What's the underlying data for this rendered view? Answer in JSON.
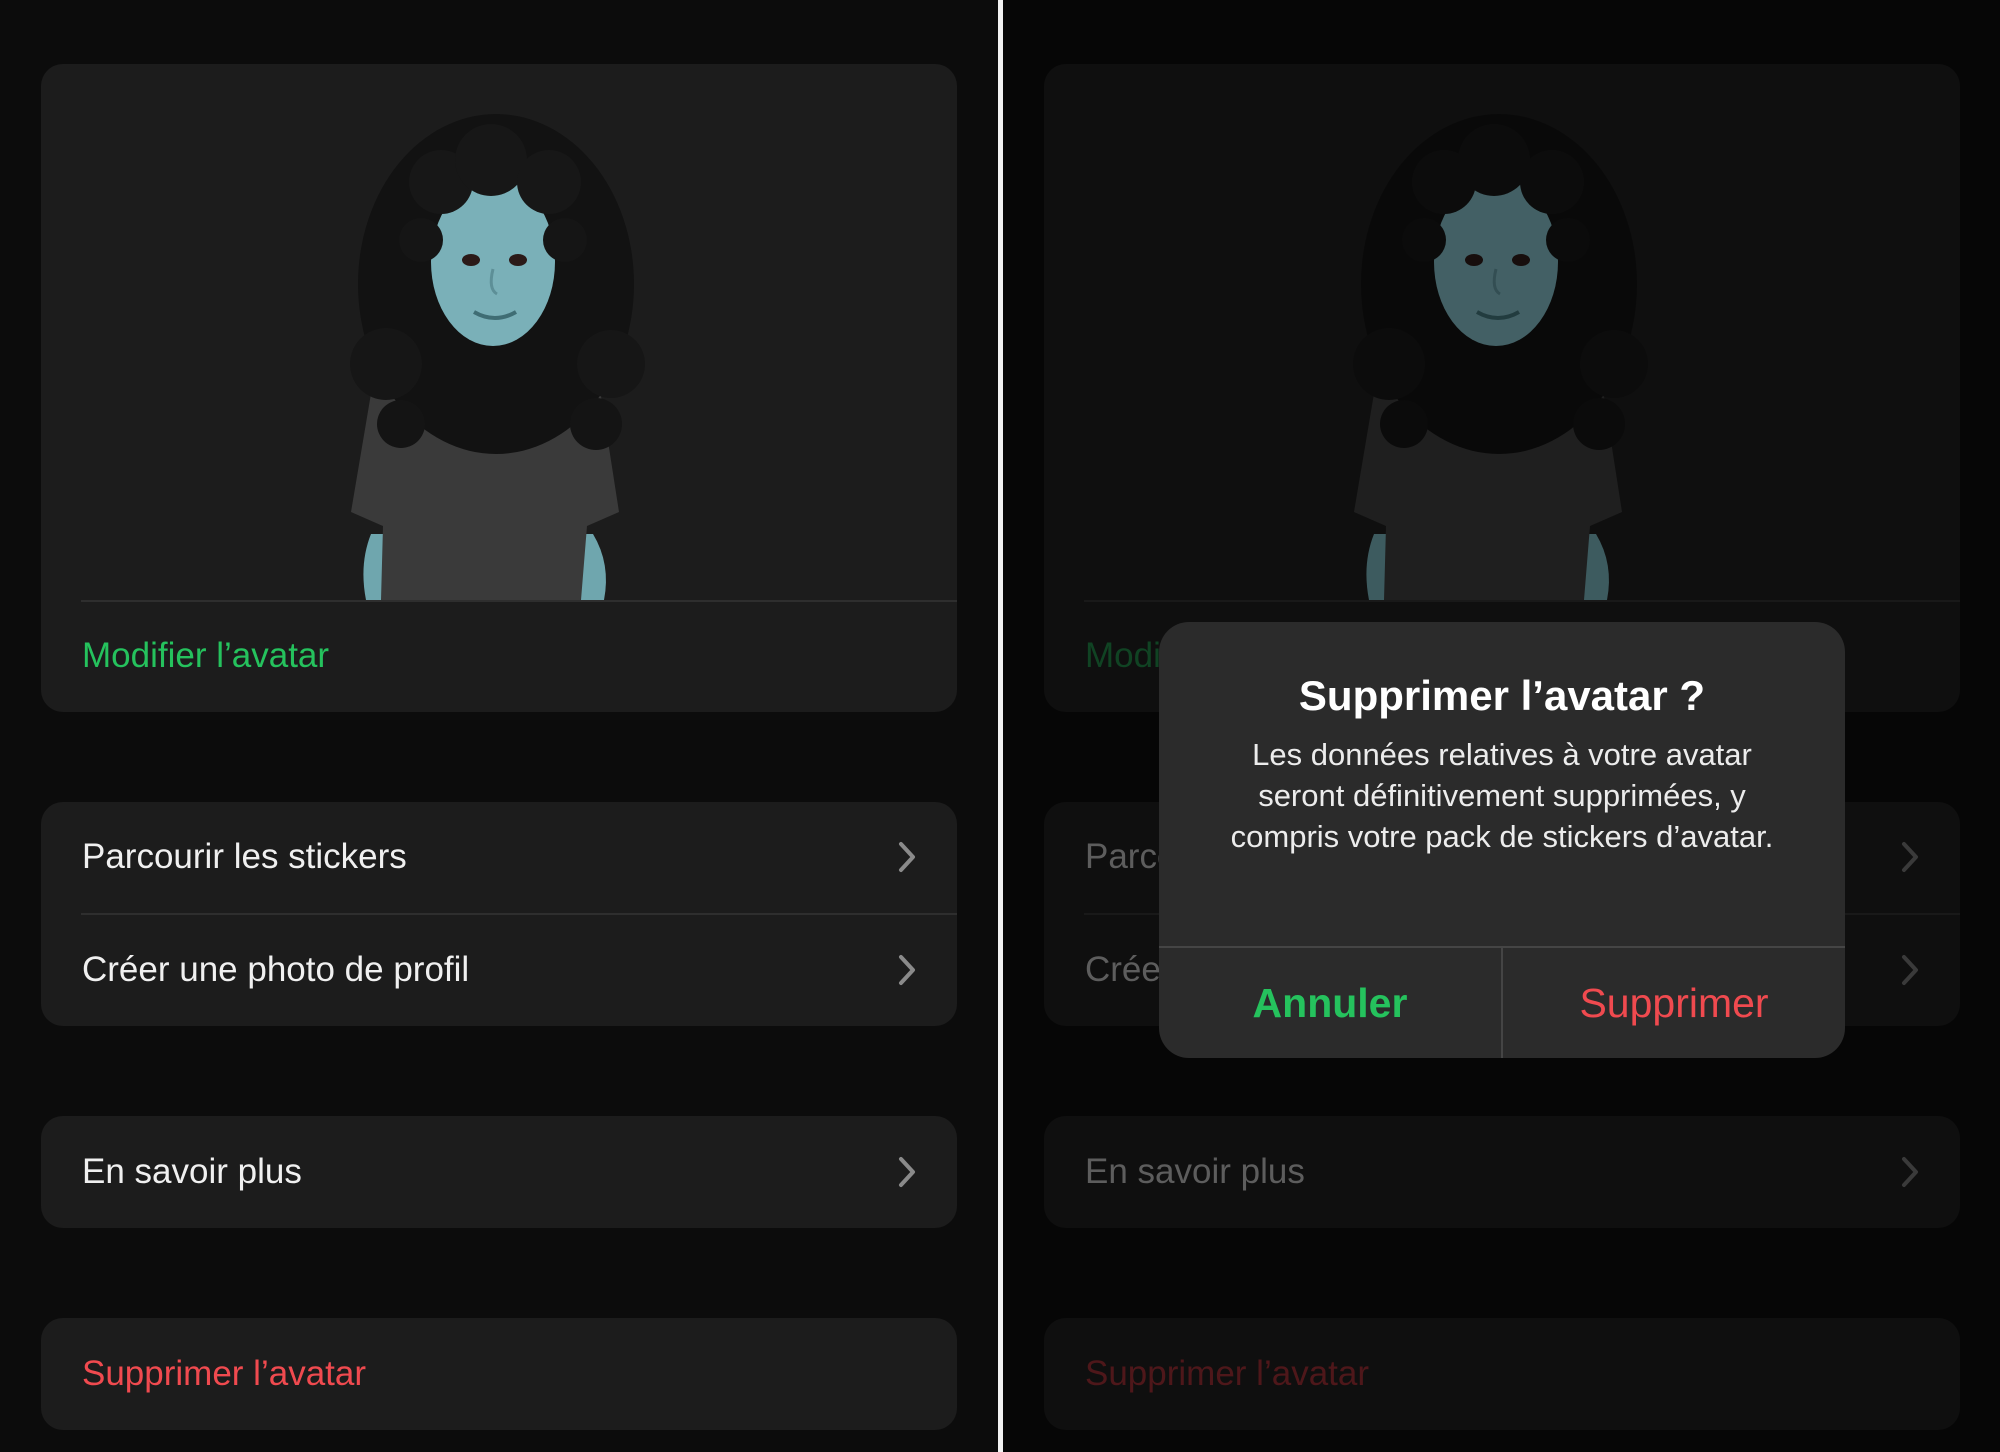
{
  "colors": {
    "accent_green": "#25c25d",
    "destructive_red": "#f04a4f",
    "background": "#0c0c0c",
    "card": "#1c1c1c"
  },
  "settings": {
    "edit_avatar": "Modifier l’avatar",
    "menu_items": [
      {
        "label": "Parcourir les stickers",
        "icon": "chevron-right-icon"
      },
      {
        "label": "Créer une photo de profil",
        "icon": "chevron-right-icon"
      }
    ],
    "learn_more": {
      "label": "En savoir plus",
      "icon": "chevron-right-icon"
    },
    "delete_avatar": "Supprimer l’avatar"
  },
  "dialog": {
    "title": "Supprimer l’avatar ?",
    "message": "Les données relatives à votre avatar seront définitivement supprimées, y compris votre pack de stickers d’avatar.",
    "cancel_label": "Annuler",
    "confirm_label": "Supprimer"
  }
}
